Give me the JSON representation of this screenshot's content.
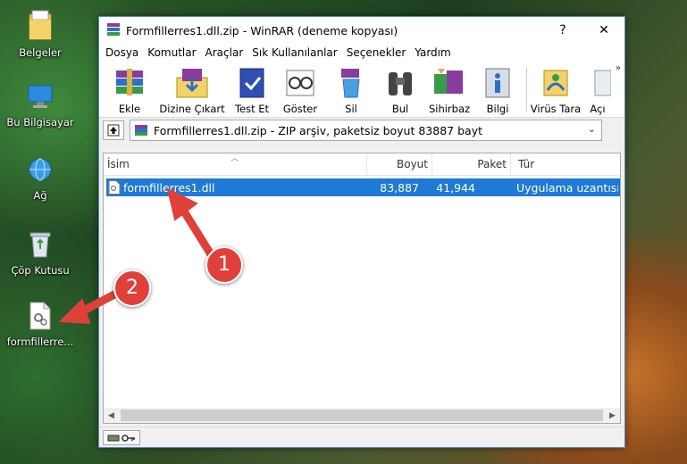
{
  "desktop": {
    "icons": [
      {
        "label": "Belgeler",
        "icon": "documents-folder-icon"
      },
      {
        "label": "Bu Bilgisayar",
        "icon": "computer-icon"
      },
      {
        "label": "Ağ",
        "icon": "network-icon"
      },
      {
        "label": "Çöp Kutusu",
        "icon": "recycle-bin-icon"
      },
      {
        "label": "formfillerre...",
        "icon": "dll-file-icon"
      }
    ]
  },
  "window": {
    "title": "Formfillerres1.dll.zip - WinRAR (deneme kopyası)",
    "help_button": "?",
    "close_button": "✕",
    "menu": [
      "Dosya",
      "Komutlar",
      "Araçlar",
      "Sık Kullanılanlar",
      "Seçenekler",
      "Yardım"
    ],
    "toolbar": [
      {
        "label": "Ekle",
        "icon": "add-archive-icon"
      },
      {
        "label": "Dizine Çıkart",
        "icon": "extract-to-icon"
      },
      {
        "label": "Test Et",
        "icon": "test-icon"
      },
      {
        "label": "Göster",
        "icon": "view-icon"
      },
      {
        "label": "Sil",
        "icon": "delete-icon"
      },
      {
        "label": "Bul",
        "icon": "find-icon"
      },
      {
        "label": "Sihirbaz",
        "icon": "wizard-icon"
      },
      {
        "label": "Bilgi",
        "icon": "info-icon"
      },
      {
        "label": "Virüs Tara",
        "icon": "virus-scan-icon"
      },
      {
        "label": "Açı",
        "icon": "open-icon"
      }
    ],
    "toolbar_more": "»",
    "address": "Formfillerres1.dll.zip - ZIP arşiv, paketsiz boyut 83887 bayt",
    "columns": [
      "İsim",
      "Boyut",
      "Paket",
      "Tür"
    ],
    "files": [
      {
        "name": "formfillerres1.dll",
        "size": "83,887",
        "packed": "41,944",
        "type": "Uygulama uzantısı"
      }
    ]
  },
  "annotations": {
    "badge1": "1",
    "badge2": "2",
    "color": "#e0403a"
  }
}
